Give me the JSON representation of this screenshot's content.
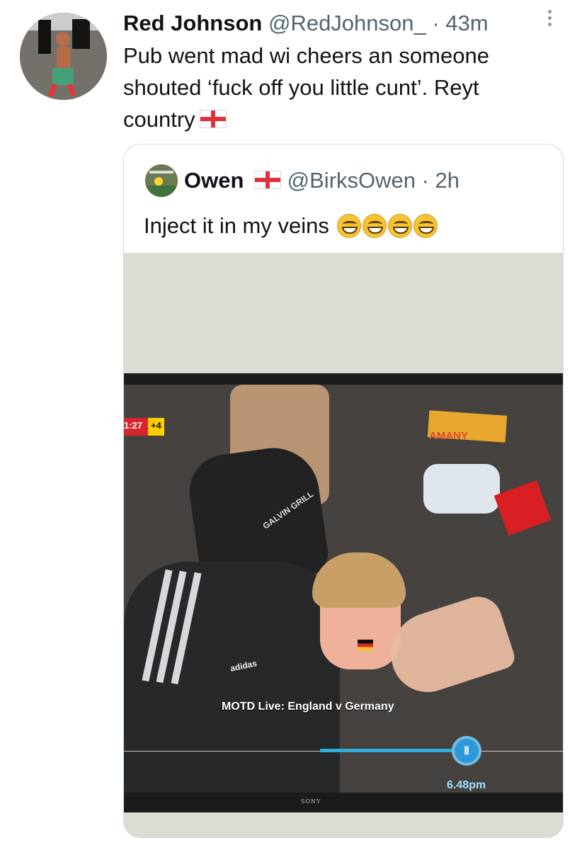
{
  "tweet": {
    "author_name": "Red Johnson",
    "handle": "@RedJohnson_",
    "time": "· 43m",
    "text": "Pub went mad wi cheers an someone shouted ‘fuck off you little cunt’. Reyt country",
    "flag": "england-flag-icon"
  },
  "quoted_tweet": {
    "author_name": "Owen",
    "handle": "@BirksOwen",
    "time": "· 2h",
    "text": "Inject it in my veins",
    "emoji_count": 4,
    "flag": "england-flag-icon"
  },
  "media": {
    "score_time": "1:27",
    "score_added": "+4",
    "shirt_text": "AMANY",
    "cap_text": "GALVIN GRILL",
    "sportswear_text": "adidas",
    "caption": "MOTD Live: England v Germany",
    "clock": "6.48pm",
    "tv_brand": "SONY",
    "progress": 0.78
  },
  "colors": {
    "text": "#0f1419",
    "muted": "#536471",
    "border": "#cfd9de",
    "progress": "#2fb0d8"
  }
}
